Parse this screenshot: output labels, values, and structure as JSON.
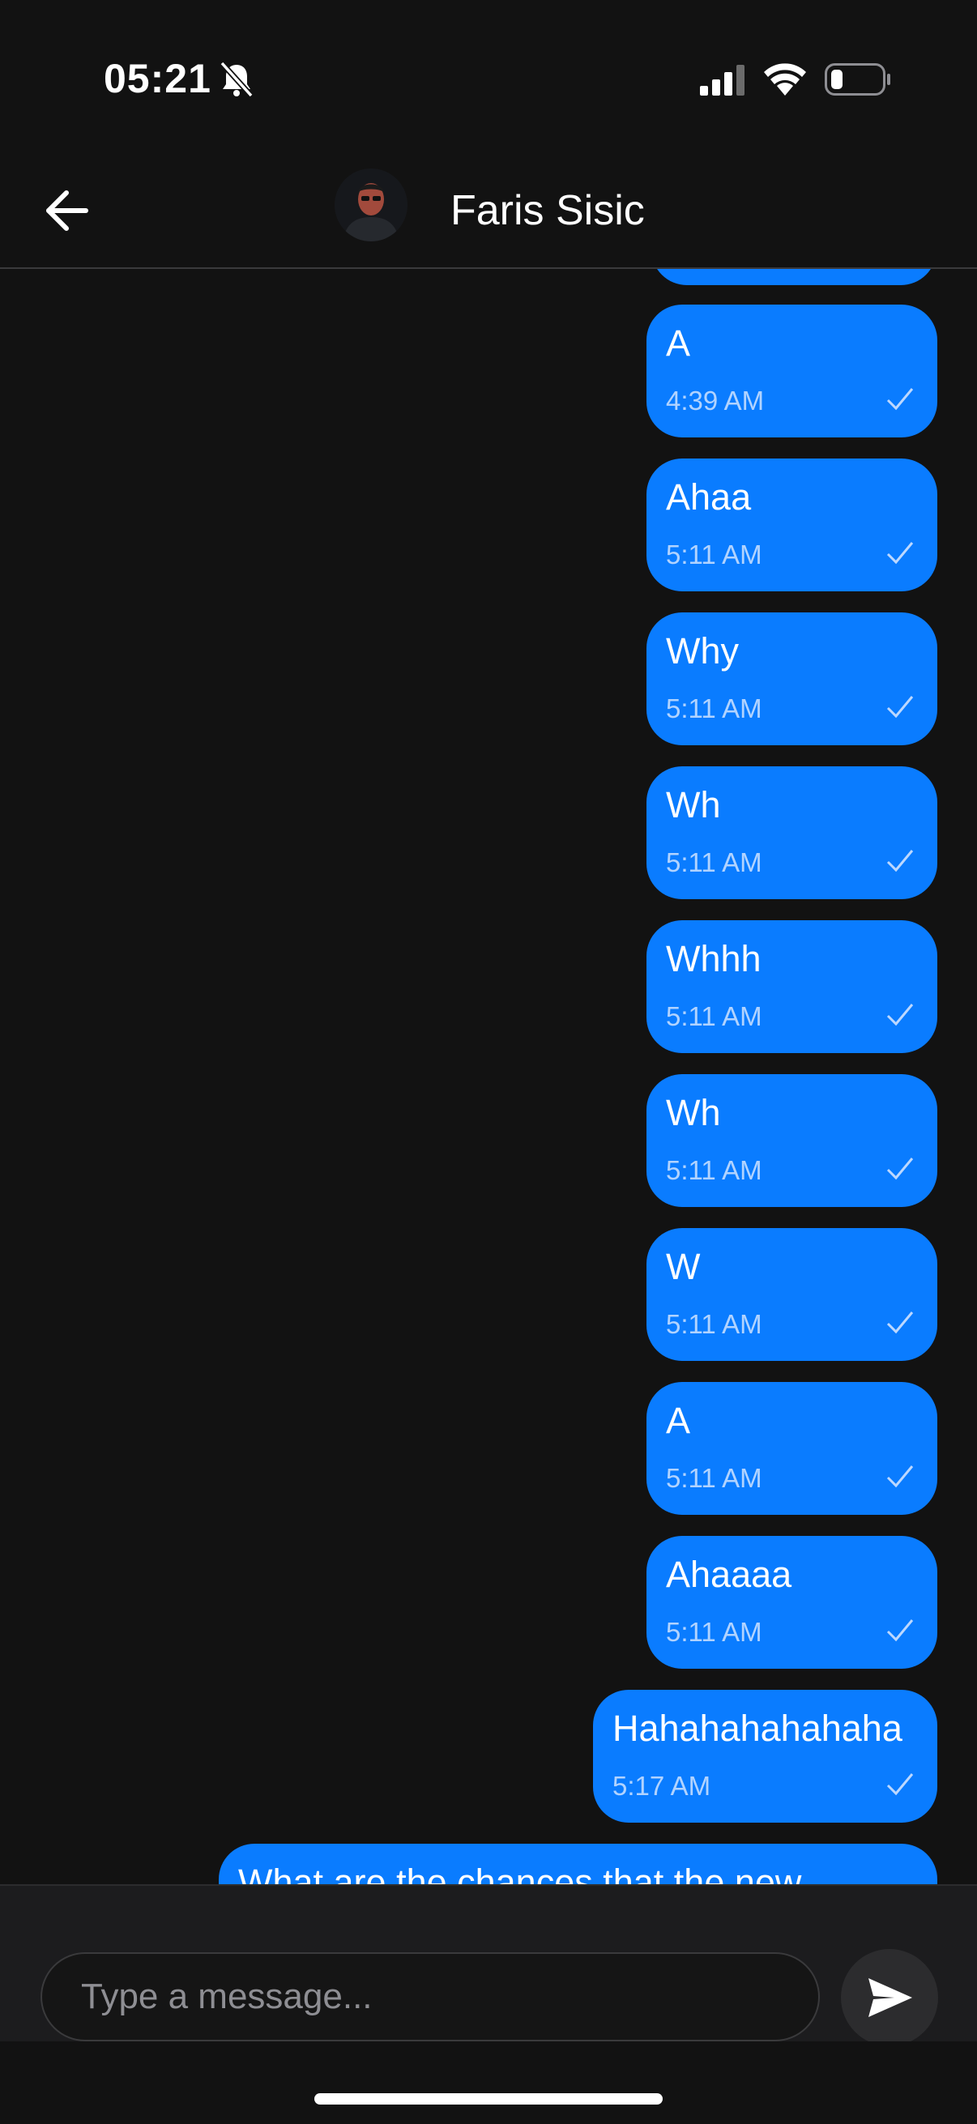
{
  "status_bar": {
    "time": "05:21",
    "icons": [
      "bell-slash-icon",
      "signal-icon",
      "wifi-icon",
      "battery-icon"
    ]
  },
  "header": {
    "contact_name": "Faris Sisic",
    "back_icon": "arrow-left-icon"
  },
  "messages": [
    {
      "text": "A",
      "time": "4:39 AM",
      "status_icon": "check-icon"
    },
    {
      "text": "Ahaa",
      "time": "5:11 AM",
      "status_icon": "check-icon"
    },
    {
      "text": "Why",
      "time": "5:11 AM",
      "status_icon": "check-icon"
    },
    {
      "text": "Wh",
      "time": "5:11 AM",
      "status_icon": "check-icon"
    },
    {
      "text": "Whhh",
      "time": "5:11 AM",
      "status_icon": "check-icon"
    },
    {
      "text": "Wh",
      "time": "5:11 AM",
      "status_icon": "check-icon"
    },
    {
      "text": "W",
      "time": "5:11 AM",
      "status_icon": "check-icon"
    },
    {
      "text": "A",
      "time": "5:11 AM",
      "status_icon": "check-icon"
    },
    {
      "text": "Ahaaaa",
      "time": "5:11 AM",
      "status_icon": "check-icon"
    },
    {
      "text": "Hahahahahahaha",
      "time": "5:17 AM",
      "status_icon": "check-icon"
    },
    {
      "text": "What are the chances that the new",
      "time": "",
      "status_icon": ""
    }
  ],
  "composer": {
    "placeholder": "Type a message...",
    "value": "",
    "send_icon": "send-icon"
  },
  "colors": {
    "background": "#121212",
    "bubble": "#0a7cff",
    "input_bar": "#1c1c1e"
  }
}
